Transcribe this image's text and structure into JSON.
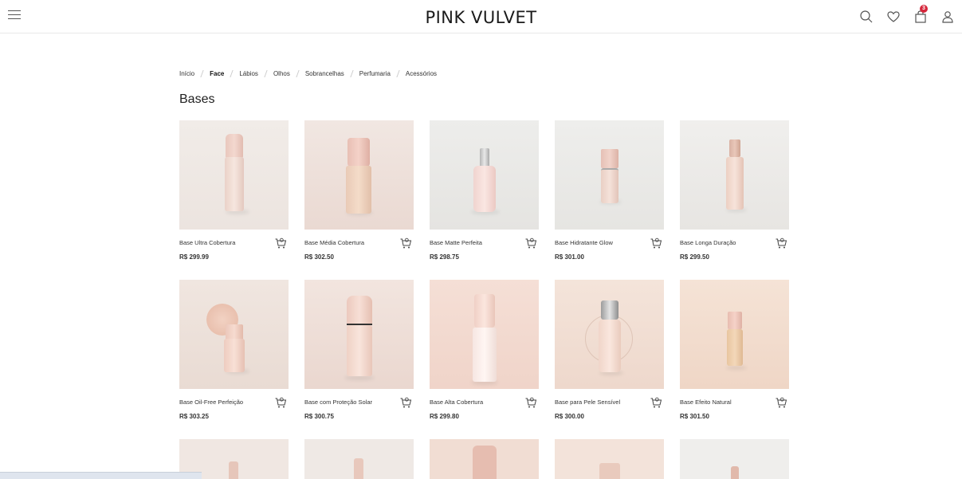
{
  "header": {
    "brand": "PINK VULVET",
    "cart_count": "3",
    "icons": [
      "menu-icon",
      "search-icon",
      "heart-icon",
      "shopping-bag-icon",
      "user-icon"
    ]
  },
  "breadcrumb": [
    "Início",
    "Face",
    "Lábios",
    "Olhos",
    "Sobrancelhas",
    "Perfumaria",
    "Acessórios"
  ],
  "breadcrumb_active": "Face",
  "page_title": "Bases",
  "currency": "R$",
  "products": [
    {
      "name": "Base Ultra Cobertura",
      "price": "R$ 299.99"
    },
    {
      "name": "Base Média Cobertura",
      "price": "R$ 302.50"
    },
    {
      "name": "Base Matte Perfeita",
      "price": "R$ 298.75"
    },
    {
      "name": "Base Hidratante Glow",
      "price": "R$ 301.00"
    },
    {
      "name": "Base Longa Duração",
      "price": "R$ 299.50"
    },
    {
      "name": "Base Oil-Free Perfeição",
      "price": "R$ 303.25"
    },
    {
      "name": "Base com Proteção Solar",
      "price": "R$ 300.75"
    },
    {
      "name": "Base Alta Cobertura",
      "price": "R$ 299.80"
    },
    {
      "name": "Base para Pele Sensível",
      "price": "R$ 300.00"
    },
    {
      "name": "Base Efeito Natural",
      "price": "R$ 301.50"
    }
  ],
  "colors": {
    "badge": "#d6273c",
    "text": "#222222"
  }
}
